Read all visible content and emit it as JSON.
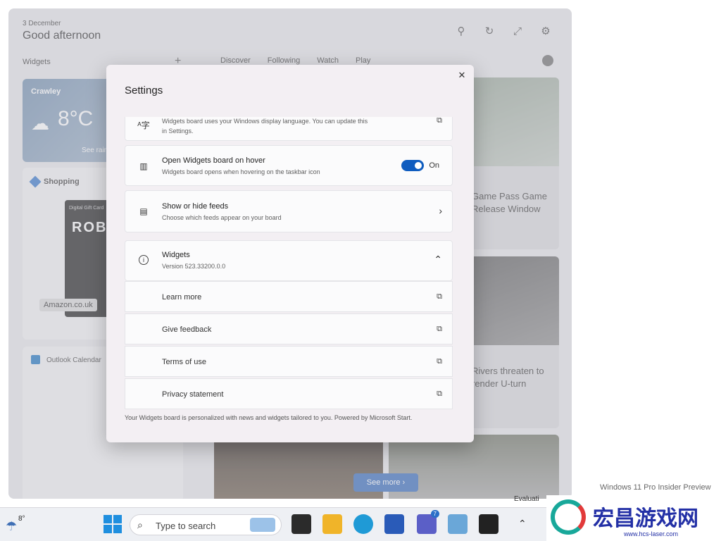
{
  "board": {
    "date": "3 December",
    "greeting": "Good afternoon",
    "widgets_label": "Widgets",
    "add_label": "+",
    "tabs": [
      "Discover",
      "Following",
      "Watch",
      "Play"
    ],
    "weather": {
      "city": "Crawley",
      "temp": "8°C",
      "see_more": "See rain"
    },
    "shopping": {
      "title": "Shopping",
      "card_small": "Digital Gift Card",
      "card_logo": "ROBLOX",
      "store": "Amazon.co.uk"
    },
    "calendar": {
      "title": "Outlook Calendar"
    },
    "news": [
      {
        "headline": "Game Pass Game Release Window"
      },
      {
        "headline": "Rivers threaten to render U-turn"
      }
    ],
    "see_more": "See more"
  },
  "dialog": {
    "title": "Settings",
    "language_desc": "Widgets board uses your Windows display language. You can update this in Settings.",
    "hover": {
      "title": "Open Widgets board on hover",
      "desc": "Widgets board opens when hovering on the taskbar icon",
      "state": "On"
    },
    "feeds": {
      "title": "Show or hide feeds",
      "desc": "Choose which feeds appear on your board"
    },
    "about": {
      "title": "Widgets",
      "version": "Version 523.33200.0.0"
    },
    "links": [
      "Learn more",
      "Give feedback",
      "Terms of use",
      "Privacy statement"
    ],
    "footer": "Your Widgets board is personalized with news and widgets tailored to you. Powered by Microsoft Start."
  },
  "taskbar": {
    "weather_temp": "8°",
    "search_placeholder": "Type to search",
    "badge": "7"
  },
  "watermark": {
    "os": "Windows 11 Pro Insider Preview",
    "evaluation": "Evaluati",
    "site_cn": "宏昌游戏网",
    "site_url": "www.hcs-laser.com"
  }
}
